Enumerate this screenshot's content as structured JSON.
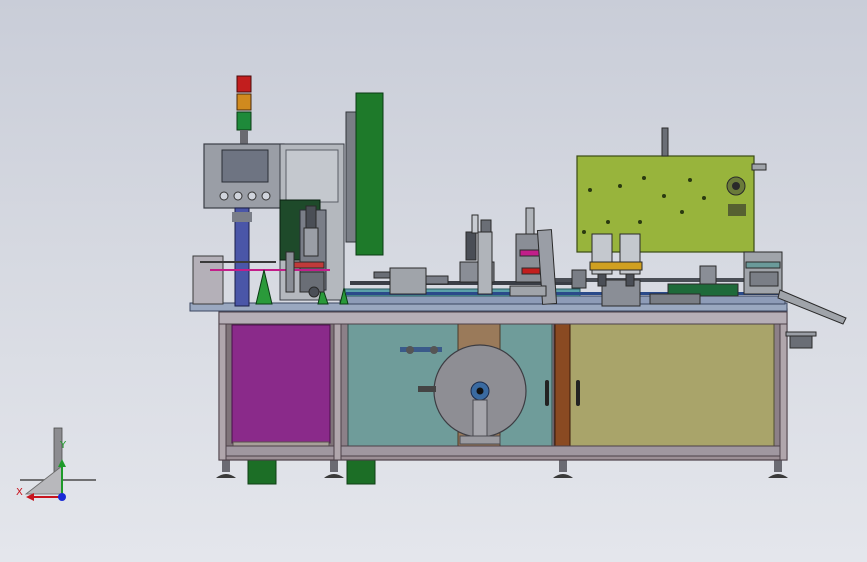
{
  "view": {
    "background_top": "#c9cdd8",
    "background_bottom": "#e4e6ec"
  },
  "triad": {
    "x_label": "X",
    "y_label": "Y",
    "x_color": "#c8141e",
    "y_color": "#1e9a2a",
    "z_color": "#1a2bd6"
  },
  "colors": {
    "frame_steel": "#8a7f86",
    "panel_magenta": "#8a2a8a",
    "panel_teal": "#6f9c9a",
    "panel_olive": "#a9a46a",
    "door_brown": "#8a4a22",
    "wire_green": "#1e7a2a",
    "machine_lime": "#98b43c",
    "hmi_gray": "#9a9ea6",
    "tower_red": "#c21e1e",
    "tower_amber": "#d08a1e",
    "tower_green": "#1e8a3a"
  },
  "hmi": {
    "buttons": [
      "start-button",
      "stop-button",
      "reset-button",
      "emergency-button"
    ]
  }
}
